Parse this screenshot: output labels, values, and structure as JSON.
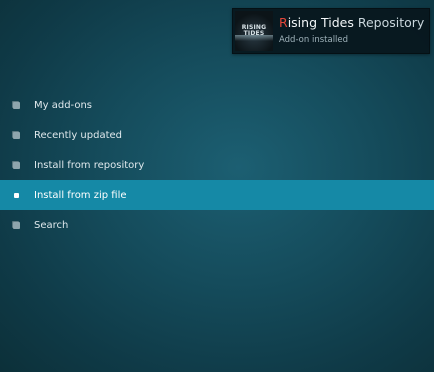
{
  "notification": {
    "title_first_letter": "R",
    "title_rest": "ising Tides",
    "title_suffix": "Repository",
    "subtitle": "Add-on installed",
    "thumbnail_logo_text": "RISING TIDES",
    "icon": "addon-logo"
  },
  "menu": {
    "items": [
      {
        "label": "My add-ons",
        "icon": "bullet-icon",
        "focused": false
      },
      {
        "label": "Recently updated",
        "icon": "bullet-icon",
        "focused": false
      },
      {
        "label": "Install from repository",
        "icon": "bullet-icon",
        "focused": false
      },
      {
        "label": "Install from zip file",
        "icon": "bullet-icon",
        "focused": true
      },
      {
        "label": "Search",
        "icon": "bullet-icon",
        "focused": false
      }
    ]
  },
  "colors": {
    "background": "#154c5c",
    "focus_highlight": "#1589a6",
    "title_accent": "#e2463a"
  }
}
